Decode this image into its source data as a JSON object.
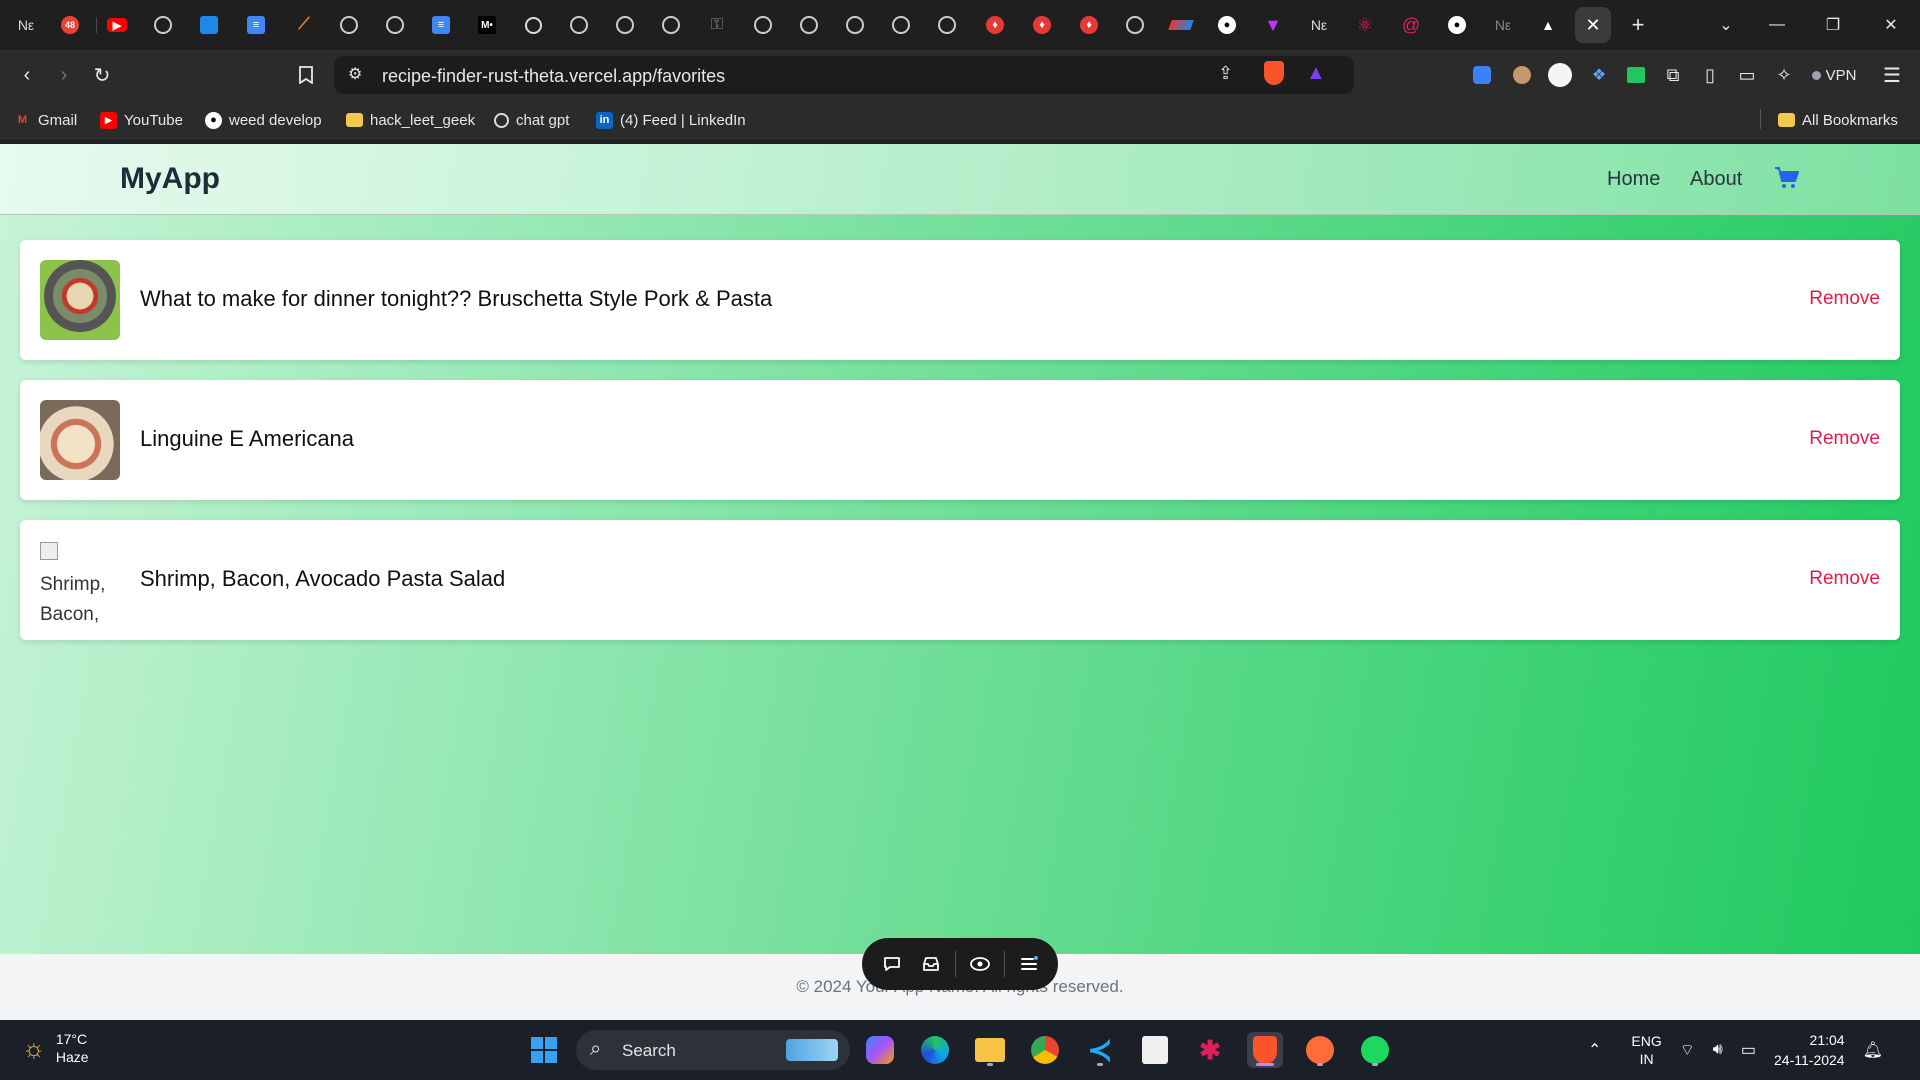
{
  "browser": {
    "url": "recipe-finder-rust-theta.vercel.app/favorites",
    "tab_badge": "48",
    "tab_text_new": "Nε",
    "tab_medium": "M•",
    "vpn_label": "VPN",
    "bookmarks": [
      {
        "label": "Gmail",
        "icon": "gmail-icon",
        "color": "#ea4335"
      },
      {
        "label": "YouTube",
        "icon": "youtube-icon",
        "color": "#ff0000"
      },
      {
        "label": "weed develop",
        "icon": "github-icon",
        "color": "#ffffff"
      },
      {
        "label": "hack_leet_geek",
        "icon": "folder-icon",
        "color": "#f2c94c"
      },
      {
        "label": "chat gpt",
        "icon": "openai-icon",
        "color": "#e8e8e8"
      },
      {
        "label": "(4) Feed | LinkedIn",
        "icon": "linkedin-icon",
        "color": "#0a66c2"
      }
    ],
    "all_bookmarks": "All Bookmarks"
  },
  "app": {
    "brand": "MyApp",
    "nav": {
      "home": "Home",
      "about": "About"
    },
    "favorites": [
      {
        "title": "What to make for dinner tonight?? Bruschetta Style Pork & Pasta",
        "action": "Remove"
      },
      {
        "title": "Linguine E Americana",
        "action": "Remove"
      },
      {
        "title": "Shrimp, Bacon, Avocado Pasta Salad",
        "action": "Remove",
        "alt_line1": "Shrimp,",
        "alt_line2": "Bacon,"
      }
    ],
    "footer": "© 2024 Your App Name. All rights reserved.",
    "accent": "#e11d48",
    "cart_color": "#2563eb"
  },
  "taskbar": {
    "temperature": "17°C",
    "weather": "Haze",
    "search_placeholder": "Search",
    "lang1": "ENG",
    "lang2": "IN",
    "time": "21:04",
    "date": "24-11-2024"
  }
}
